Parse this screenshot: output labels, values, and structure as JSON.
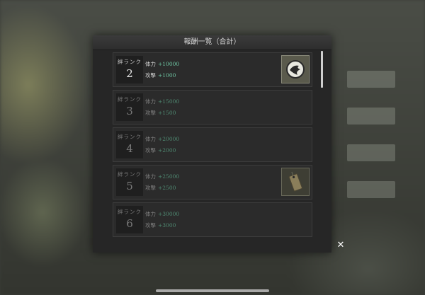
{
  "modal": {
    "title": "報酬一覧（合計）",
    "close_glyph": "✕"
  },
  "rewards": [
    {
      "rank_label": "絆ランク",
      "rank": "2",
      "hp_label": "体力",
      "hp_value": "+10000",
      "atk_label": "攻撃",
      "atk_value": "+1000",
      "icon": "emblem-icon",
      "active": true
    },
    {
      "rank_label": "絆ランク",
      "rank": "3",
      "hp_label": "体力",
      "hp_value": "+15000",
      "atk_label": "攻撃",
      "atk_value": "+1500",
      "icon": null,
      "active": false
    },
    {
      "rank_label": "絆ランク",
      "rank": "4",
      "hp_label": "体力",
      "hp_value": "+20000",
      "atk_label": "攻撃",
      "atk_value": "+2000",
      "icon": null,
      "active": false
    },
    {
      "rank_label": "絆ランク",
      "rank": "5",
      "hp_label": "体力",
      "hp_value": "+25000",
      "atk_label": "攻撃",
      "atk_value": "+2500",
      "icon": "tag-icon",
      "active": false
    },
    {
      "rank_label": "絆ランク",
      "rank": "6",
      "hp_label": "体力",
      "hp_value": "+30000",
      "atk_label": "攻撃",
      "atk_value": "+3000",
      "icon": null,
      "active": false
    }
  ],
  "colors": {
    "accent_value": "#6fc7a4",
    "panel_bg": "#262626"
  }
}
